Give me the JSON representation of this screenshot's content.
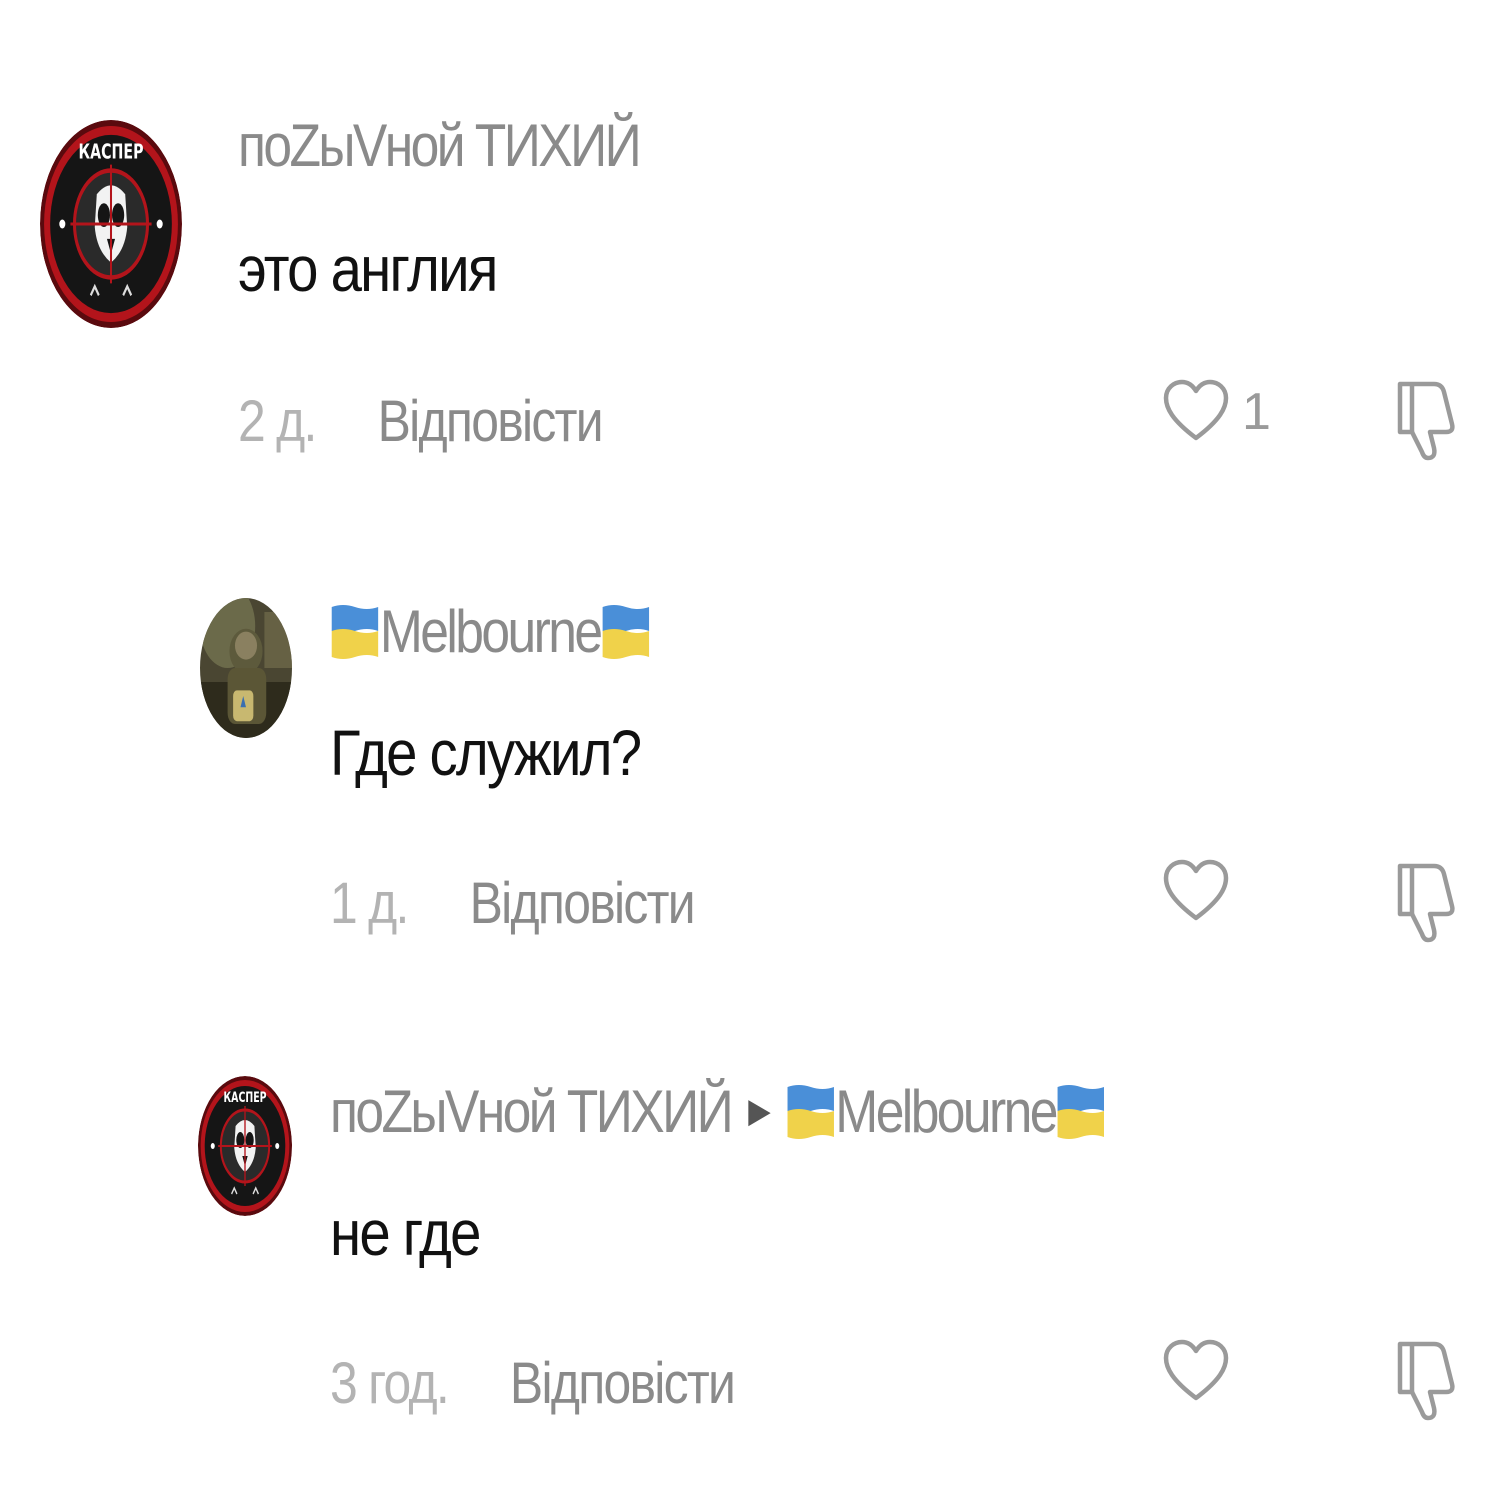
{
  "comments": [
    {
      "author": "поZыVной ТИХИЙ",
      "text": "это англия",
      "time": "2 д.",
      "reply_label": "Відповісти",
      "likes": "1",
      "avatar": "kasper-emblem"
    },
    {
      "author": "Melbourne",
      "author_flag": "ukraine-flag",
      "text": "Где служил?",
      "time": "1 д.",
      "reply_label": "Відповісти",
      "avatar": "soldier-photo"
    },
    {
      "author": "поZыVной ТИХИЙ",
      "reply_to": "Melbourne",
      "reply_to_flag": "ukraine-flag",
      "text": "не где",
      "time": "3 год.",
      "reply_label": "Відповісти",
      "avatar": "kasper-emblem"
    }
  ],
  "colors": {
    "flag_blue": "#4a8fd8",
    "flag_yellow": "#f0d24a",
    "emblem_red": "#b3141b"
  },
  "icons": {
    "like": "heart-outline-icon",
    "dislike": "thumbs-down-outline-icon",
    "reply_arrow": "caret-right-icon"
  }
}
